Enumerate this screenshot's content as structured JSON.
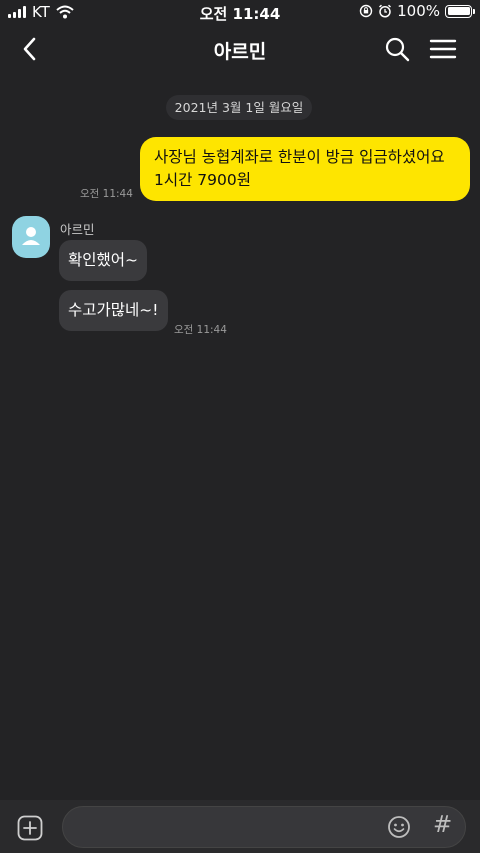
{
  "status_bar": {
    "carrier": "KT",
    "time": "오전 11:44",
    "battery": "100%"
  },
  "header": {
    "title": "아르민",
    "icons": [
      "back-arrow-icon",
      "search-icon",
      "menu-icon"
    ]
  },
  "chat": {
    "date_divider": "2021년 3월 1일 월요일",
    "my_message": {
      "line1": "사장님 농협계좌로 한분이 방금 입금하셨어요",
      "line2": "1시간 7900원",
      "time": "오전 11:44",
      "bubble_color": "#fee500"
    },
    "sender_name": "아르민",
    "other_messages": [
      {
        "text": "확인했어~"
      },
      {
        "text": "수고가많네~!"
      }
    ],
    "other_time": "오전 11:44"
  },
  "composer": {
    "input_value": "",
    "hash_symbol": "#",
    "icons": [
      "plus-icon",
      "emoji-icon",
      "hash-icon"
    ]
  },
  "colors": {
    "background": "#232325",
    "my_bubble": "#fee500",
    "other_bubble": "#3a3a3d"
  }
}
